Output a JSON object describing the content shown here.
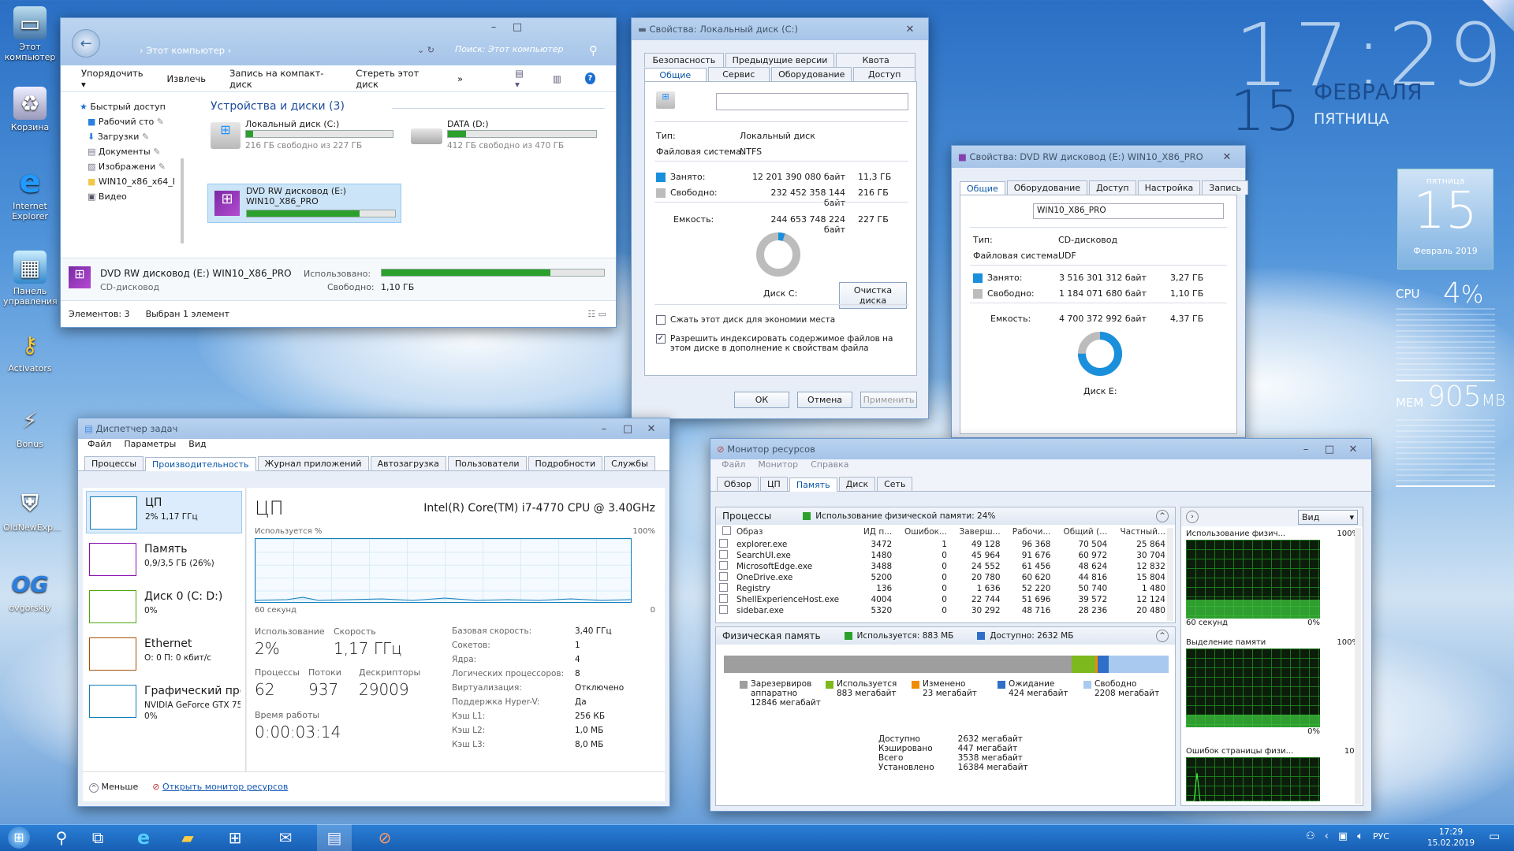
{
  "desktop": {
    "icons": [
      "Этот компьютер",
      "Корзина",
      "Internet Explorer",
      "Панель управления",
      "Activators",
      "Bonus",
      "OldNewExp...",
      "ovgorskiy"
    ]
  },
  "clock": {
    "time": "17:29",
    "day": "15",
    "month": "ФЕВРАЛЯ",
    "weekday": "ПЯТНИЦА"
  },
  "calendar": {
    "weekday": "пятница",
    "day": "15",
    "month_year": "Февраль 2019"
  },
  "gauges": {
    "cpu_label": "CPU",
    "cpu_value": "4",
    "cpu_unit": "%",
    "cpu_level": 0.04,
    "mem_label": "MEM",
    "mem_value": "905",
    "mem_unit": "MB",
    "mem_level": 0.06
  },
  "explorer": {
    "path": "Этот компьютер",
    "search_placeholder": "Поиск: Этот компьютер",
    "toolbar": [
      "Упорядочить ▾",
      "Извлечь",
      "Запись на компакт-диск",
      "Стереть этот диск",
      "»"
    ],
    "nav": [
      "Быстрый доступ",
      "Рабочий сто",
      "Загрузки",
      "Документы",
      "Изображени",
      "WIN10_x86_x64_I",
      "Видео"
    ],
    "group_title": "Устройства и диски (3)",
    "drives": [
      {
        "name": "Локальный диск (C:)",
        "free": "216 ГБ свободно из 227 ГБ",
        "used": 0.05
      },
      {
        "name": "DATA (D:)",
        "free": "412 ГБ свободно из 470 ГБ",
        "used": 0.12
      },
      {
        "name": "DVD RW дисковод (E:)",
        "name2": "WIN10_X86_PRO",
        "used": 0.76
      }
    ],
    "details": {
      "name": "DVD RW дисковод (E:) WIN10_X86_PRO",
      "type": "CD-дисковод",
      "used_label": "Использовано:",
      "free_label": "Свободно:",
      "free_value": "1,10 ГБ",
      "used": 0.76
    },
    "status": {
      "items": "Элементов: 3",
      "selected": "Выбран 1 элемент"
    }
  },
  "propC": {
    "title": "Свойства: Локальный диск (C:)",
    "tabs_row1": [
      "Безопасность",
      "Предыдущие версии",
      "Квота"
    ],
    "tabs_row2": [
      "Общие",
      "Сервис",
      "Оборудование",
      "Доступ"
    ],
    "type_label": "Тип:",
    "type_value": "Локальный диск",
    "fs_label": "Файловая система:",
    "fs_value": "NTFS",
    "used_label": "Занято:",
    "used_bytes": "12 201 390 080 байт",
    "used_gb": "11,3 ГБ",
    "free_label": "Свободно:",
    "free_bytes": "232 452 358 144 байт",
    "free_gb": "216 ГБ",
    "cap_label": "Емкость:",
    "cap_bytes": "244 653 748 224 байт",
    "cap_gb": "227 ГБ",
    "disk_label": "Диск C:",
    "used_fraction": 0.05,
    "cleanup": "Очистка диска",
    "compress": "Сжать этот диск для экономии места",
    "index": "Разрешить индексировать содержимое файлов на этом диске в дополнение к свойствам файла",
    "ok": "ОК",
    "cancel": "Отмена",
    "apply": "Применить"
  },
  "propE": {
    "title": "Свойства: DVD RW дисковод (E:) WIN10_X86_PRO",
    "tabs": [
      "Общие",
      "Оборудование",
      "Доступ",
      "Настройка",
      "Запись"
    ],
    "label_value": "WIN10_X86_PRO",
    "type_label": "Тип:",
    "type_value": "CD-дисковод",
    "fs_label": "Файловая система:",
    "fs_value": "UDF",
    "used_label": "Занято:",
    "used_bytes": "3 516 301 312 байт",
    "used_gb": "3,27 ГБ",
    "free_label": "Свободно:",
    "free_bytes": "1 184 071 680 байт",
    "free_gb": "1,10 ГБ",
    "cap_label": "Емкость:",
    "cap_bytes": "4 700 372 992 байт",
    "cap_gb": "4,37 ГБ",
    "disk_label": "Диск E:",
    "used_fraction": 0.75
  },
  "taskmgr": {
    "title": "Диспетчер задач",
    "menu": [
      "Файл",
      "Параметры",
      "Вид"
    ],
    "tabs": [
      "Процессы",
      "Производительность",
      "Журнал приложений",
      "Автозагрузка",
      "Пользователи",
      "Подробности",
      "Службы"
    ],
    "sidebar": [
      {
        "title": "ЦП",
        "sub": "2% 1,17 ГГц",
        "color": "#117dbb"
      },
      {
        "title": "Память",
        "sub": "0,9/3,5 ГБ (26%)",
        "color": "#8b12ae"
      },
      {
        "title": "Диск 0 (C: D:)",
        "sub": "0%",
        "color": "#4da60c"
      },
      {
        "title": "Ethernet",
        "sub": "О: 0 П: 0 кбит/с",
        "color": "#a74f01"
      },
      {
        "title": "Графический про",
        "sub": "NVIDIA GeForce GTX 75",
        "sub2": "0%",
        "color": "#117dbb"
      }
    ],
    "heading": "ЦП",
    "cpu_name": "Intel(R) Core(TM) i7-4770 CPU @ 3.40GHz",
    "graph_top_left": "Используется %",
    "graph_top_right": "100%",
    "graph_bottom_left": "60 секунд",
    "graph_bottom_right": "0",
    "usage_label": "Использование",
    "usage_value": "2%",
    "speed_label": "Скорость",
    "speed_value": "1,17 ГГц",
    "proc_label": "Процессы",
    "proc_value": "62",
    "threads_label": "Потоки",
    "threads_value": "937",
    "handles_label": "Дескрипторы",
    "handles_value": "29009",
    "uptime_label": "Время работы",
    "uptime_value": "0:00:03:14",
    "specs": [
      [
        "Базовая скорость:",
        "3,40 ГГц"
      ],
      [
        "Сокетов:",
        "1"
      ],
      [
        "Ядра:",
        "4"
      ],
      [
        "Логических процессоров:",
        "8"
      ],
      [
        "Виртуализация:",
        "Отключено"
      ],
      [
        "Поддержка Hyper-V:",
        "Да"
      ],
      [
        "Кэш L1:",
        "256 КБ"
      ],
      [
        "Кэш L2:",
        "1,0 МБ"
      ],
      [
        "Кэш L3:",
        "8,0 МБ"
      ]
    ],
    "less": "Меньше",
    "open_resmon": "Открыть монитор ресурсов"
  },
  "resmon": {
    "title": "Монитор ресурсов",
    "menu": [
      "Файл",
      "Монитор",
      "Справка"
    ],
    "tabs": [
      "Обзор",
      "ЦП",
      "Память",
      "Диск",
      "Сеть"
    ],
    "proc_header": "Процессы",
    "proc_usage": "Использование физической памяти: 24%",
    "columns": [
      "Образ",
      "ИД п...",
      "Ошибок...",
      "Заверш...",
      "Рабочи...",
      "Общий (...",
      "Частный..."
    ],
    "rows": [
      [
        "explorer.exe",
        "3472",
        "1",
        "49 128",
        "96 368",
        "70 504",
        "25 864"
      ],
      [
        "SearchUI.exe",
        "1480",
        "0",
        "45 964",
        "91 676",
        "60 972",
        "30 704"
      ],
      [
        "MicrosoftEdge.exe",
        "3488",
        "0",
        "24 552",
        "61 456",
        "48 624",
        "12 832"
      ],
      [
        "OneDrive.exe",
        "5200",
        "0",
        "20 780",
        "60 620",
        "44 816",
        "15 804"
      ],
      [
        "Registry",
        "136",
        "0",
        "1 636",
        "52 220",
        "50 740",
        "1 480"
      ],
      [
        "ShellExperienceHost.exe",
        "4004",
        "0",
        "22 744",
        "51 696",
        "39 572",
        "12 124"
      ],
      [
        "sidebar.exe",
        "5320",
        "0",
        "30 292",
        "48 716",
        "28 236",
        "20 480"
      ]
    ],
    "phys_header": "Физическая память",
    "phys_used": "Используется: 883 МБ",
    "phys_avail": "Доступно: 2632 МБ",
    "legend": [
      {
        "name": "Зарезервиров аппаратно",
        "value": "12846 мегабайт",
        "color": "#9e9e9e",
        "mb": 12846
      },
      {
        "name": "Используется",
        "value": "883 мегабайт",
        "color": "#7db91c",
        "mb": 883
      },
      {
        "name": "Изменено",
        "value": "23 мегабайт",
        "color": "#f08c00",
        "mb": 23
      },
      {
        "name": "Ожидание",
        "value": "424 мегабайт",
        "color": "#2f6fc7",
        "mb": 424
      },
      {
        "name": "Свободно",
        "value": "2208 мегабайт",
        "color": "#a9c9ef",
        "mb": 2208
      }
    ],
    "summary": [
      [
        "Доступно",
        "2632 мегабайт"
      ],
      [
        "Кэшировано",
        "447 мегабайт"
      ],
      [
        "Всего",
        "3538 мегабайт"
      ],
      [
        "Установлено",
        "16384 мегабайт"
      ]
    ],
    "view_btn": "Вид",
    "charts": [
      {
        "label": "Использование физич...",
        "top": "100%",
        "bl": "60 секунд",
        "br": "0%"
      },
      {
        "label": "Выделение памяти",
        "top": "100%",
        "br": "0%"
      },
      {
        "label": "Ошибок страницы физи...",
        "top": "100"
      }
    ]
  },
  "taskbar": {
    "lang": "РУС",
    "time": "17:29",
    "date": "15.02.2019"
  }
}
